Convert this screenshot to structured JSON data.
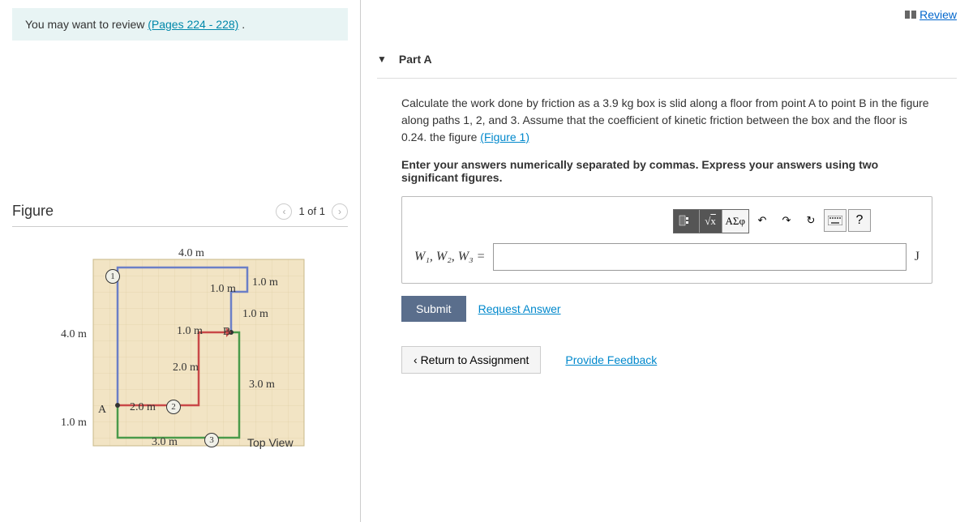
{
  "left": {
    "hint_prefix": "You may want to review ",
    "hint_link": "(Pages 224 - 228)",
    "hint_suffix": " .",
    "figure_title": "Figure",
    "nav_text": "1 of 1"
  },
  "figure": {
    "dim_top": "4.0 m",
    "dim_left": "4.0 m",
    "dim_1m_a": "1.0 m",
    "dim_1m_b": "1.0 m",
    "dim_1m_c": "1.0 m",
    "dim_1m_d": "1.0 m",
    "dim_1m_e": "1.0 m",
    "dim_2m_a": "2.0 m",
    "dim_2m_b": "2.0 m",
    "dim_3m_a": "3.0 m",
    "dim_3m_b": "3.0 m",
    "point_a": "A",
    "point_b": "B",
    "path1": "1",
    "path2": "2",
    "path3": "3",
    "caption": "Top View"
  },
  "right": {
    "review": "Review",
    "part_title": "Part A",
    "question": "Calculate the work done by friction as a 3.9 kg box is slid along a floor from point A to point B in the figure along paths 1, 2, and 3. Assume that the coefficient of kinetic friction between the box and the floor is 0.24. the figure ",
    "figure_link": "(Figure 1)",
    "instruction": "Enter your answers numerically separated by commas. Express your answers using two significant figures.",
    "answer_label": "W₁, W₂, W₃ =",
    "unit": "J",
    "submit": "Submit",
    "request_answer": "Request Answer",
    "return": "Return to Assignment",
    "feedback": "Provide Feedback",
    "tool_sigma": "ΑΣφ",
    "tool_help": "?"
  }
}
